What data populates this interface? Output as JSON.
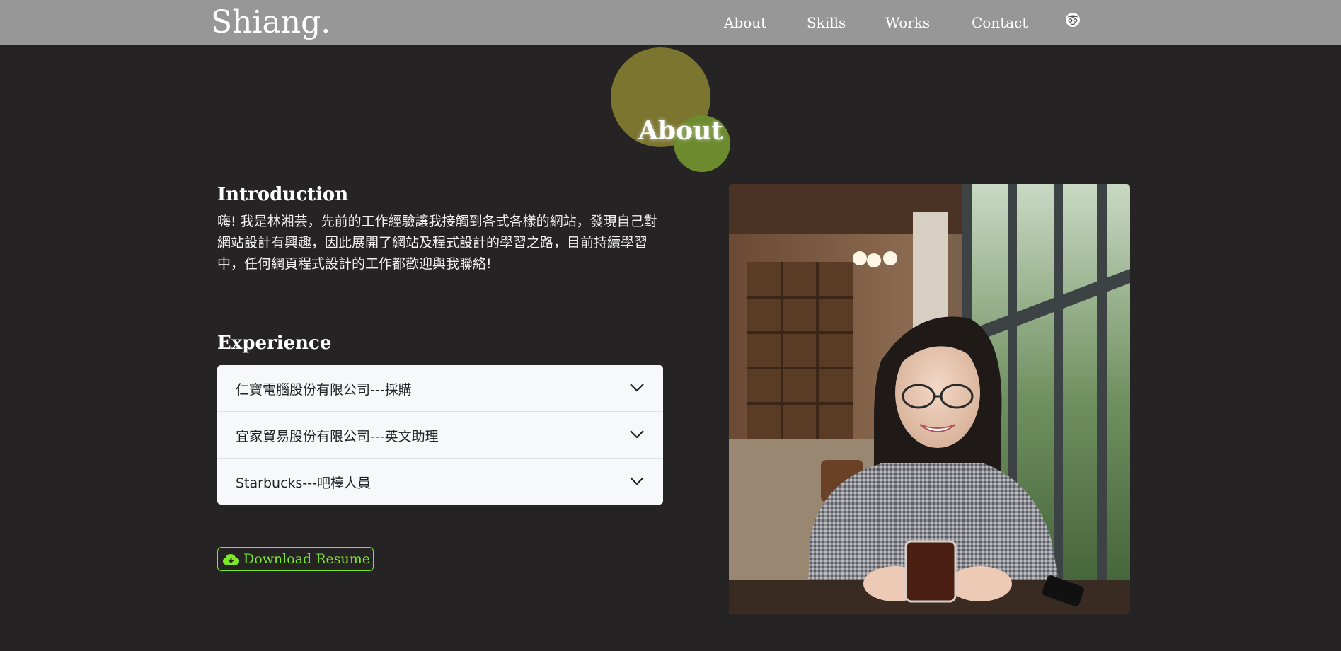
{
  "navbar": {
    "brand": "Shiang.",
    "links": [
      {
        "label": "About"
      },
      {
        "label": "Skills"
      },
      {
        "label": "Works"
      },
      {
        "label": "Contact"
      }
    ],
    "theme_icon": "face-icon"
  },
  "section": {
    "title": "About"
  },
  "intro": {
    "heading": "Introduction",
    "text": "嗨! 我是林湘芸，先前的工作經驗讓我接觸到各式各樣的網站，發現自己對網站設計有興趣，因此展開了網站及程式設計的學習之路，目前持續學習中，任何網頁程式設計的工作都歡迎與我聯絡!"
  },
  "experience": {
    "heading": "Experience",
    "items": [
      {
        "label": "仁寶電腦股份有限公司---採購"
      },
      {
        "label": "宜家貿易股份有限公司---英文助理"
      },
      {
        "label": "Starbucks---吧檯人員"
      }
    ]
  },
  "resume": {
    "label": "Download Resume",
    "icon": "cloud-download-icon"
  },
  "colors": {
    "navbar_bg": "#979797",
    "page_bg": "#252324",
    "accent_green": "#7ee82a",
    "bubble_olive": "#7b7530",
    "bubble_green": "#6c8a2e"
  }
}
